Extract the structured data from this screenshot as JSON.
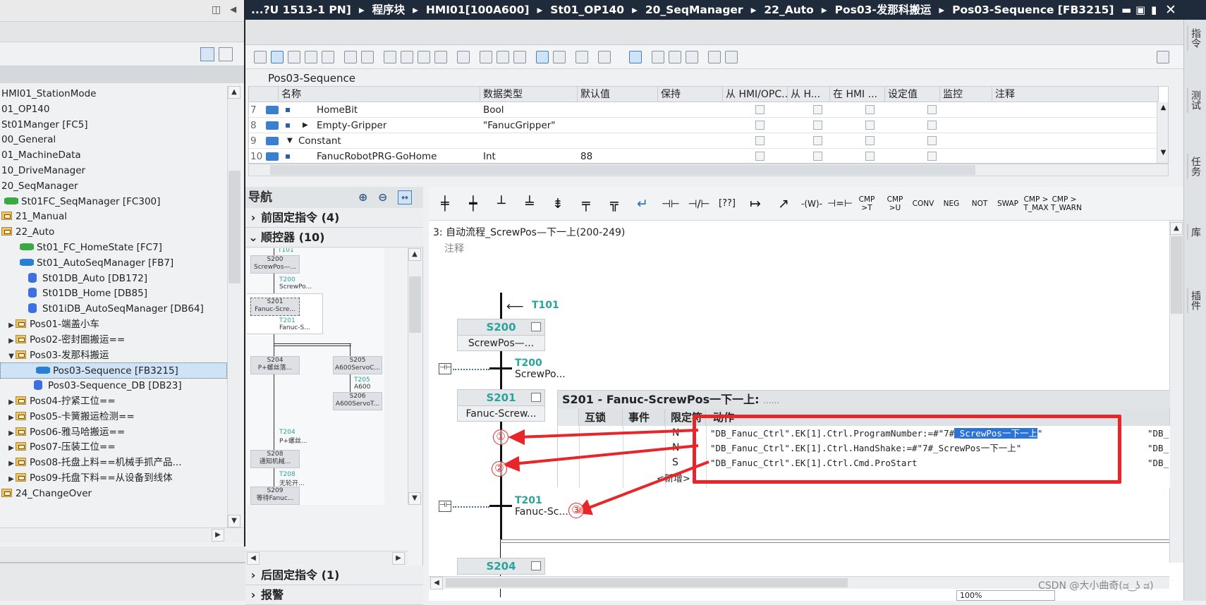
{
  "titlebar": {
    "breadcrumb": [
      "...?U 1513-1 PN]",
      "程序块",
      "HMI01[100A600]",
      "St01_OP140",
      "20_SeqManager",
      "22_Auto",
      "Pos03-发那科搬运",
      "Pos03-Sequence [FB3215]"
    ],
    "sep": "▸"
  },
  "tree": {
    "items": [
      {
        "label": "HMI01_StationMode",
        "icon": "none",
        "indent": 0,
        "expand": ""
      },
      {
        "label": "01_OP140",
        "icon": "none",
        "indent": 0,
        "expand": ""
      },
      {
        "label": "St01Manger [FC5]",
        "icon": "none",
        "indent": 0,
        "expand": ""
      },
      {
        "label": "00_General",
        "icon": "none",
        "indent": 0,
        "expand": ""
      },
      {
        "label": "01_MachineData",
        "icon": "none",
        "indent": 0,
        "expand": ""
      },
      {
        "label": "10_DriveManager",
        "icon": "none",
        "indent": 0,
        "expand": ""
      },
      {
        "label": "20_SeqManager",
        "icon": "none",
        "indent": 0,
        "expand": ""
      },
      {
        "label": "St01FC_SeqManager [FC300]",
        "icon": "fc",
        "indent": 0,
        "expand": ""
      },
      {
        "label": "21_Manual",
        "icon": "folder",
        "indent": 0,
        "expand": ""
      },
      {
        "label": "22_Auto",
        "icon": "folder",
        "indent": 0,
        "expand": ""
      },
      {
        "label": "St01_FC_HomeState [FC7]",
        "icon": "fc",
        "indent": 1,
        "expand": ""
      },
      {
        "label": "St01_AutoSeqManager [FB7]",
        "icon": "fb",
        "indent": 1,
        "expand": ""
      },
      {
        "label": "St01DB_Auto [DB172]",
        "icon": "db",
        "indent": 1,
        "expand": ""
      },
      {
        "label": "St01DB_Home [DB85]",
        "icon": "db",
        "indent": 1,
        "expand": ""
      },
      {
        "label": "St01iDB_AutoSeqManager [DB64]",
        "icon": "db",
        "indent": 1,
        "expand": ""
      },
      {
        "label": "Pos01-端盖小车",
        "icon": "folder",
        "indent": 1,
        "expand": "▶"
      },
      {
        "label": "Pos02-密封圈搬运==",
        "icon": "folder",
        "indent": 1,
        "expand": "▶"
      },
      {
        "label": "Pos03-发那科搬运",
        "icon": "folder",
        "indent": 1,
        "expand": "▼"
      },
      {
        "label": "Pos03-Sequence [FB3215]",
        "icon": "fb",
        "indent": 2,
        "expand": "",
        "selected": true
      },
      {
        "label": "Pos03-Sequence_DB [DB23]",
        "icon": "db",
        "indent": 2,
        "expand": ""
      },
      {
        "label": "Pos04-拧紧工位==",
        "icon": "folder",
        "indent": 1,
        "expand": "▶"
      },
      {
        "label": "Pos05-卡簧搬运检测==",
        "icon": "folder",
        "indent": 1,
        "expand": "▶"
      },
      {
        "label": "Pos06-雅马哈搬运==",
        "icon": "folder",
        "indent": 1,
        "expand": "▶"
      },
      {
        "label": "Pos07-压装工位==",
        "icon": "folder",
        "indent": 1,
        "expand": "▶"
      },
      {
        "label": "Pos08-托盘上料==机械手抓产品...",
        "icon": "folder",
        "indent": 1,
        "expand": "▶"
      },
      {
        "label": "Pos09-托盘下料==从设备到线体",
        "icon": "folder",
        "indent": 1,
        "expand": "▶"
      },
      {
        "label": "24_ChangeOver",
        "icon": "folder",
        "indent": 0,
        "expand": ""
      }
    ]
  },
  "grid": {
    "title": "Pos03-Sequence",
    "headers": [
      "名称",
      "数据类型",
      "默认值",
      "保持",
      "从 HMI/OPC..",
      "从 H...",
      "在 HMI ...",
      "设定值",
      "监控",
      "注释"
    ],
    "rows": [
      {
        "num": "7",
        "name": "HomeBit",
        "type": "Bool",
        "default": "",
        "expand": ""
      },
      {
        "num": "8",
        "name": "Empty-Gripper",
        "type": "\"FanucGripper\"",
        "default": "",
        "expand": "▶"
      },
      {
        "num": "9",
        "name": "Constant",
        "type": "",
        "default": "",
        "expand": "▼"
      },
      {
        "num": "10",
        "name": "FanucRobotPRG-GoHome",
        "type": "Int",
        "default": "88",
        "expand": ""
      }
    ]
  },
  "nav": {
    "title": "导航",
    "sec_fixed_before": "前固定指令 (4)",
    "sec_sequencer": "顺控器 (10)",
    "sec_fixed_after": "后固定指令 (1)",
    "sec_alarm": "报警",
    "mini": {
      "t101": "T101",
      "s200": "S200",
      "s200t": "ScrewPos—...",
      "t200": "T200",
      "t200t": "ScrewPo...",
      "s201": "S201",
      "s201t": "Fanuc-Scre...",
      "t201": "T201",
      "t201t": "Fanuc-S...",
      "s204": "S204",
      "s204t": "P+螺丝落...",
      "s205": "S205",
      "s205t": "A600ServoC...",
      "t205": "T205",
      "t205t": "A600",
      "s206": "S206",
      "s206t": "A600ServoT...",
      "t204": "T204",
      "t204t": "P+螺丝...",
      "s208": "S208",
      "s208t": "通知机械...",
      "t208": "T208",
      "t208t": "无轮开...",
      "s209": "S209",
      "s209t": "等待Fanuc...",
      "t209": "T209",
      "t209t": "等待Fa..."
    }
  },
  "editor": {
    "instructions": [
      "CMP >T",
      "CMP >U",
      "CONV",
      "NEG",
      "NOT",
      "SWAP",
      "CMP > T_MAX",
      "CMP > T_WARN"
    ],
    "network_title": "3:  自动流程_ScrewPos—下一上(200-249)",
    "comment": "注释",
    "t101": "T101",
    "s200": {
      "name": "S200",
      "text": "ScrewPos—..."
    },
    "t200": {
      "name": "T200",
      "text": "ScrewPo..."
    },
    "s201": {
      "name": "S201",
      "text": "Fanuc-Screw..."
    },
    "t201": {
      "name": "T201",
      "text": "Fanuc-Sc..."
    },
    "s204": {
      "name": "S204"
    }
  },
  "popup": {
    "title": "S201 - Fanuc-ScrewPos一下一上:",
    "title_suffix": "......",
    "headers": [
      "互锁",
      "事件",
      "限定符",
      "动作"
    ],
    "rows": [
      {
        "q": "N",
        "pre": "\"DB_Fanuc_Ctrl\".EK[1].Ctrl.ProgramNumber:=#\"7#",
        "sel": "_ScrewPos一下一上",
        "post": "\"",
        "right": "\"DB_"
      },
      {
        "q": "N",
        "pre": "\"DB_Fanuc_Ctrl\".EK[1].Ctrl.HandShake:=#\"7#_ScrewPos一下一上\"",
        "sel": "",
        "post": "",
        "right": "\"DB_"
      },
      {
        "q": "S",
        "pre": "\"DB_Fanuc_Ctrl\".EK[1].Ctrl.Cmd.ProStart",
        "sel": "",
        "post": "",
        "right": "\"DB_"
      }
    ],
    "new_row": "<新增>"
  },
  "annotations": [
    "①",
    "②",
    "③"
  ],
  "statusbar": {
    "zoom": "100%",
    "watermark": "CSDN @大小曲奇(ಡ ͜ ʖ ಡ)"
  },
  "rightstrip": [
    "指令",
    "测试",
    "任务",
    "库",
    "插件"
  ],
  "colors": {
    "accent": "#2aa39c",
    "annotation": "#e8262a",
    "titlebar": "#1f2a3b"
  }
}
